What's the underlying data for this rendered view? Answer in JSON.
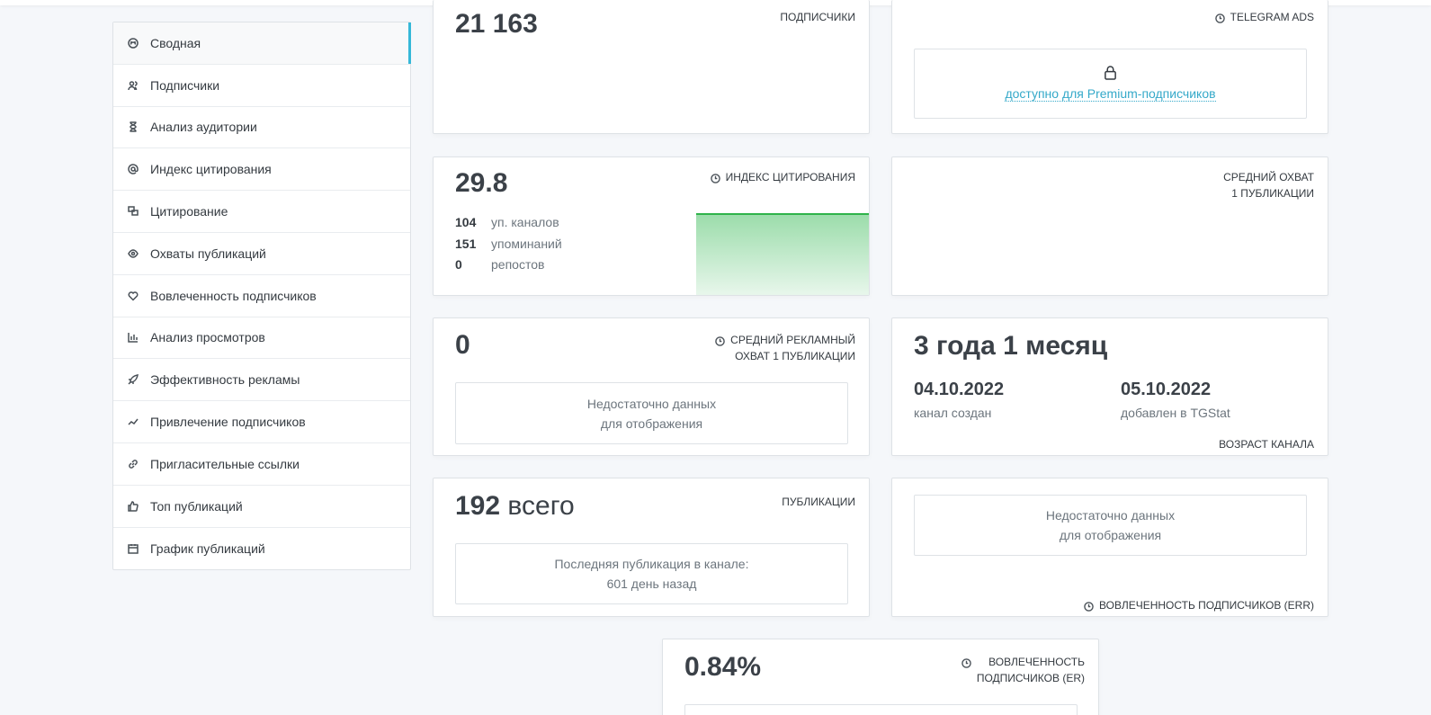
{
  "sidebar": {
    "items": [
      {
        "label": "Сводная",
        "icon": "dashboard-icon"
      },
      {
        "label": "Подписчики",
        "icon": "users-icon"
      },
      {
        "label": "Анализ аудитории",
        "icon": "hourglass-icon"
      },
      {
        "label": "Индекс цитирования",
        "icon": "at-icon"
      },
      {
        "label": "Цитирование",
        "icon": "quote-icon"
      },
      {
        "label": "Охваты публикаций",
        "icon": "eye-icon"
      },
      {
        "label": "Вовлеченность подписчиков",
        "icon": "heart-icon"
      },
      {
        "label": "Анализ просмотров",
        "icon": "bar-chart-icon"
      },
      {
        "label": "Эффективность рекламы",
        "icon": "rocket-icon"
      },
      {
        "label": "Привлечение подписчиков",
        "icon": "trend-icon"
      },
      {
        "label": "Пригласительные ссылки",
        "icon": "link-icon"
      },
      {
        "label": "Топ публикаций",
        "icon": "thumbs-up-icon"
      },
      {
        "label": "График публикаций",
        "icon": "calendar-icon"
      }
    ],
    "active_index": 0,
    "accent": "#35b8d8"
  },
  "cards": {
    "subscribers": {
      "value": "21 163",
      "label": "ПОДПИСЧИКИ"
    },
    "telegram_ads": {
      "label": "TELEGRAM ADS",
      "premium_text": "доступно для Premium-подписчиков"
    },
    "citation": {
      "value": "29.8",
      "label": "ИНДЕКС ЦИТИРОВАНИЯ",
      "stats": [
        {
          "n": "104",
          "t": "уп. каналов"
        },
        {
          "n": "151",
          "t": "упоминаний"
        },
        {
          "n": "0",
          "t": "репостов"
        }
      ],
      "chart_color": "#2fb34a"
    },
    "avg_reach": {
      "label_line1": "СРЕДНИЙ ОХВАТ",
      "label_line2": "1 ПУБЛИКАЦИИ"
    },
    "ad_reach": {
      "value": "0",
      "label_line1": "СРЕДНИЙ РЕКЛАМНЫЙ",
      "label_line2": "ОХВАТ 1 ПУБЛИКАЦИИ",
      "nodata_line1": "Недостаточно данных",
      "nodata_line2": "для отображения"
    },
    "age": {
      "value": "3 года 1 месяц",
      "created_date": "04.10.2022",
      "created_label": "канал создан",
      "added_date": "05.10.2022",
      "added_label": "добавлен в TGStat",
      "label": "ВОЗРАСТ КАНАЛА"
    },
    "publications": {
      "value": "192",
      "suffix": "всего",
      "label": "ПУБЛИКАЦИИ",
      "last_line1": "Последняя публикация в канале:",
      "last_line2": "601 день назад"
    },
    "err": {
      "nodata_line1": "Недостаточно данных",
      "nodata_line2": "для отображения",
      "label": "ВОВЛЕЧЕННОСТЬ ПОДПИСЧИКОВ (ERR)"
    },
    "er": {
      "value": "0.84%",
      "label_line1": "ВОВЛЕЧЕННОСТЬ",
      "label_line2": "ПОДПИСЧИКОВ (ER)"
    }
  }
}
